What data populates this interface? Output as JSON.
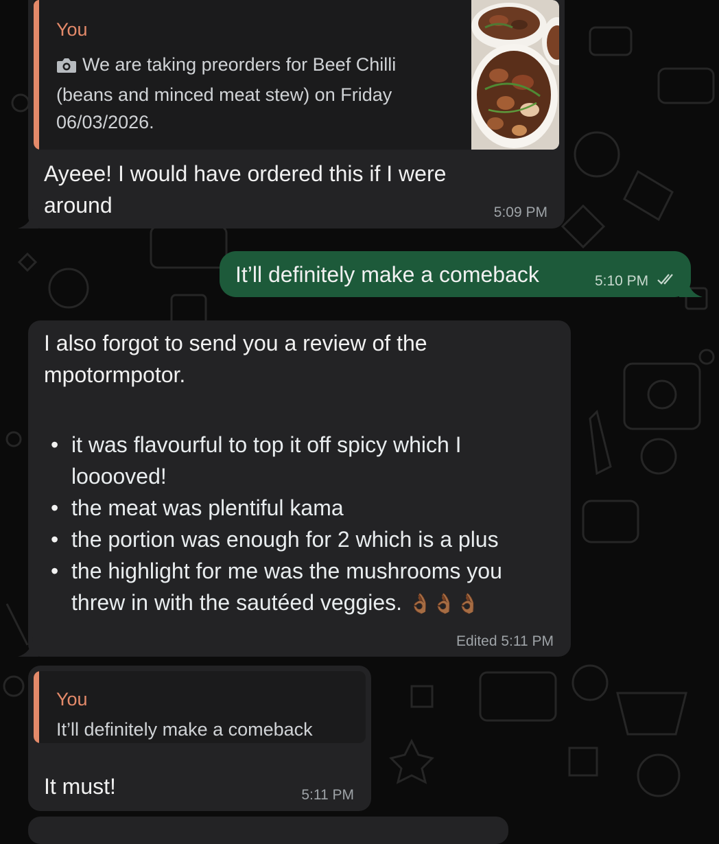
{
  "messages": {
    "m1": {
      "quote_author": "You",
      "quote_text": "We are taking preorders for Beef Chilli (beans and minced meat stew) on Friday 06/03/2026.",
      "quote_line1": "We are taking preorders for Beef Chilli",
      "quote_line2": "(beans and minced meat stew) on Friday",
      "quote_line3": "06/03/2026.",
      "quote_icon": "camera-icon",
      "text_line1": "Ayeee! I would have ordered this if I were",
      "text_line2": "around",
      "time": "5:09 PM"
    },
    "m2": {
      "text": "It’ll definitely make a comeback",
      "time": "5:10 PM",
      "status": "read"
    },
    "m3": {
      "intro_line1": "I also forgot to send you a review of the",
      "intro_line2": "mpotormpotor.",
      "bullets": [
        {
          "line1": "it was flavourful to top it off spicy which I",
          "line2": "looooved!"
        },
        {
          "line1": "the meat was plentiful kama",
          "line2": ""
        },
        {
          "line1": "the portion was enough for 2 which is a plus",
          "line2": ""
        },
        {
          "line1": "the highlight for me was the mushrooms you",
          "line2": "threw in with the sautéed veggies."
        }
      ],
      "emoji": "👌🏾👌🏾👌🏾",
      "time": "Edited 5:11 PM"
    },
    "m4": {
      "quote_author": "You",
      "quote_text": "It’ll definitely make a comeback",
      "text": "It must!",
      "time": "5:11 PM"
    }
  },
  "colors": {
    "incoming_bubble": "#232325",
    "outgoing_bubble": "#1d5a3a",
    "quote_accent": "#e48a6a",
    "background": "#0b0b0b"
  }
}
